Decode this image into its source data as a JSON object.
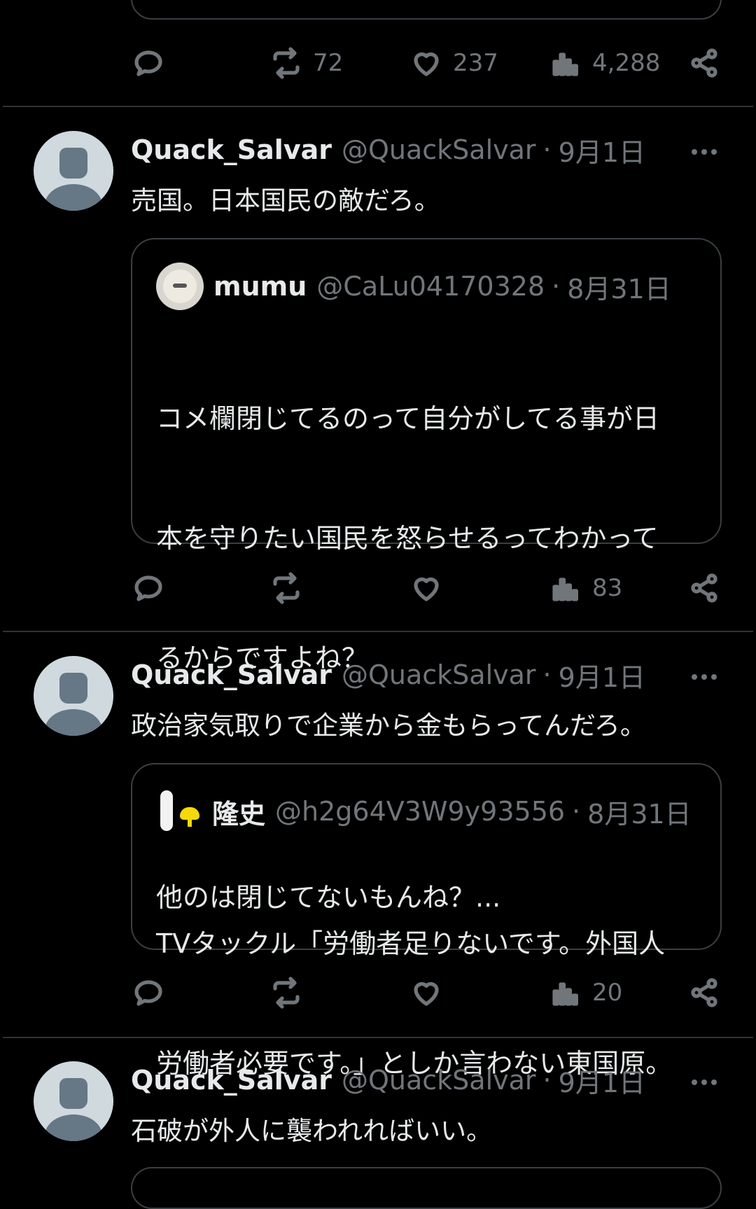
{
  "top_actions": {
    "retweets": "72",
    "likes": "237",
    "views": "4,288"
  },
  "tweets": [
    {
      "name": "Quack_Salvar",
      "handle": "@QuackSalvar",
      "separator": "·",
      "date": "9月1日",
      "text": "売国。日本国民の敵だろ。",
      "quote": {
        "name": "mumu",
        "handle": "@CaLu04170328",
        "separator": "·",
        "date": "8月31日",
        "lines": [
          "コメ欄閉じてるのって自分がしてる事が日",
          "本を守りたい国民を怒らせるってわかって",
          "るからですよね？",
          "",
          "他のは閉じてないもんね？..."
        ]
      },
      "actions": {
        "views": "83"
      }
    },
    {
      "name": "Quack_Salvar",
      "handle": "@QuackSalvar",
      "separator": "·",
      "date": "9月1日",
      "text": "政治家気取りで企業から金もらってんだろ。",
      "quote": {
        "name": "隆史",
        "handle": "@h2g64V3W9y93556",
        "separator": "·",
        "date": "8月31日",
        "lines": [
          "TVタックル「労働者足りないです。外国人",
          "労働者必要です。」としか言わない東国原。"
        ]
      },
      "actions": {
        "views": "20"
      }
    },
    {
      "name": "Quack_Salvar",
      "handle": "@QuackSalvar",
      "separator": "·",
      "date": "9月1日",
      "text": "石破が外人に襲われればいい。"
    }
  ],
  "icons": {
    "reply": "reply-icon",
    "retweet": "retweet-icon",
    "like": "heart-icon",
    "views": "views-icon",
    "share": "share-icon",
    "more": "more-icon"
  },
  "colors": {
    "background": "#000000",
    "text": "#e7e9ea",
    "muted": "#71767b",
    "border": "#2f3336"
  }
}
